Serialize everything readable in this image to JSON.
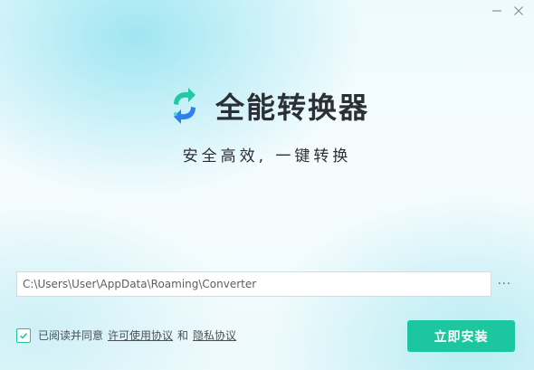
{
  "window": {
    "minimize_icon": "minimize-icon",
    "close_icon": "close-icon"
  },
  "header": {
    "app_title": "全能转换器",
    "slogan": "安全高效, 一键转换",
    "logo_icon": "convert-arrows-icon"
  },
  "install_path": {
    "value": "C:\\Users\\User\\AppData\\Roaming\\Converter",
    "browse_label": "···"
  },
  "agreement": {
    "checked": true,
    "prefix": "已阅读并同意",
    "license_link": "许可使用协议",
    "and": "和",
    "privacy_link": "隐私协议"
  },
  "actions": {
    "install_label": "立即安装"
  },
  "colors": {
    "accent": "#1cc69e",
    "logo_teal": "#23c9a6",
    "logo_blue": "#2f7ff0",
    "text_dark": "#2b2f36"
  }
}
